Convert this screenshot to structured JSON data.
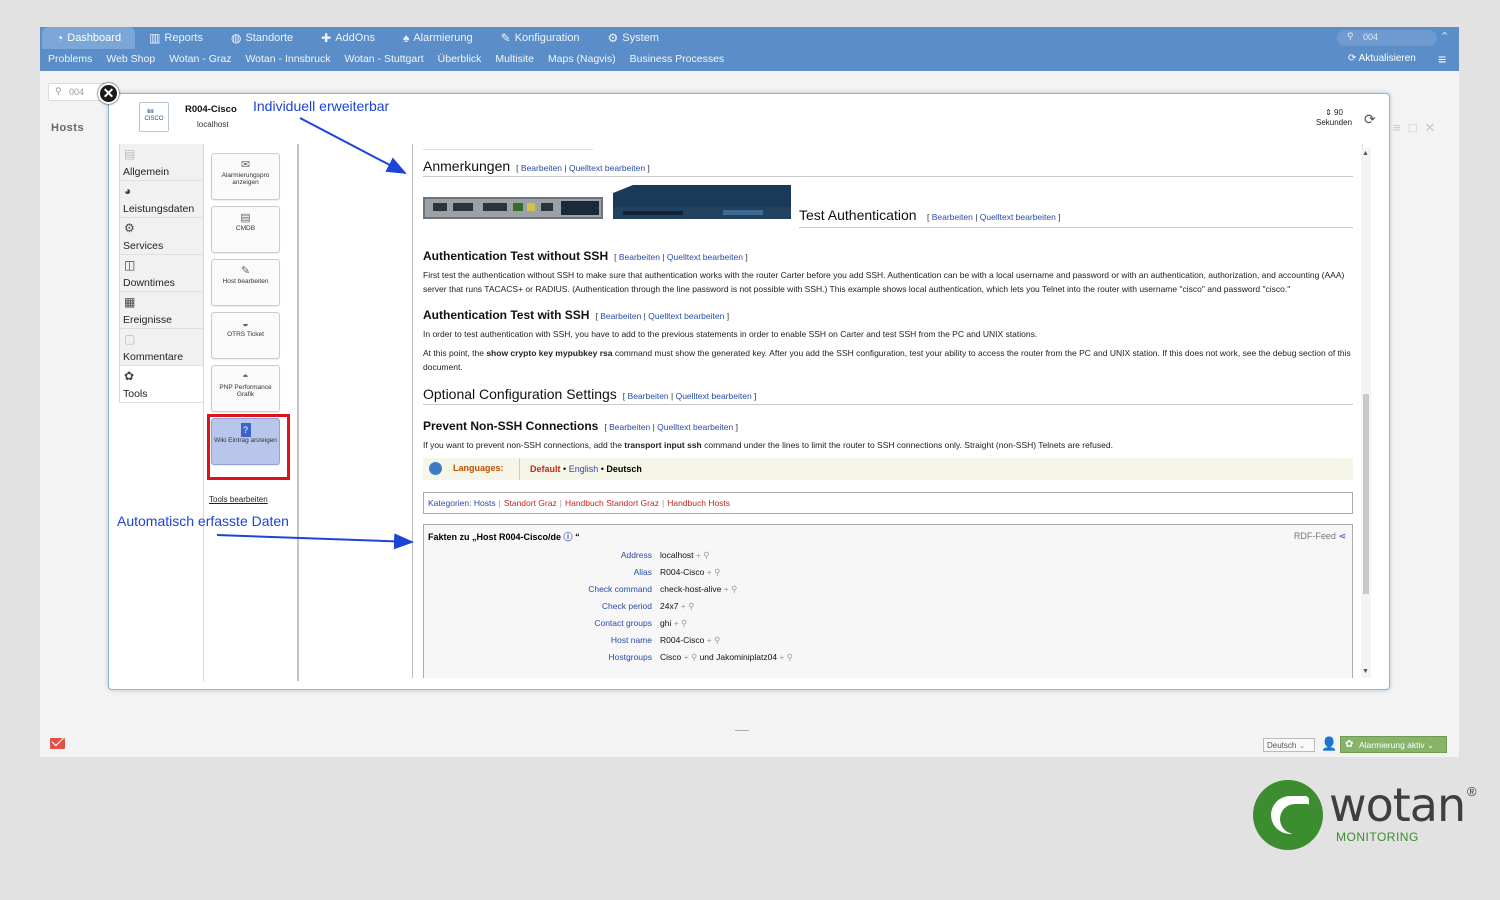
{
  "mainnav": [
    {
      "label": "Dashboard",
      "icon": "dashboard-icon",
      "glyph": "◔"
    },
    {
      "label": "Reports",
      "icon": "chart-icon",
      "glyph": "▥"
    },
    {
      "label": "Standorte",
      "icon": "globe-icon",
      "glyph": "◍"
    },
    {
      "label": "AddOns",
      "icon": "puzzle-icon",
      "glyph": "✚"
    },
    {
      "label": "Alarmierung",
      "icon": "bell-icon",
      "glyph": "♠"
    },
    {
      "label": "Konfiguration",
      "icon": "wrench-icon",
      "glyph": "✎"
    },
    {
      "label": "System",
      "icon": "gear-icon",
      "glyph": "⚙"
    }
  ],
  "subnav": [
    "Problems",
    "Web Shop",
    "Wotan - Graz",
    "Wotan - Innsbruck",
    "Wotan - Stuttgart",
    "Überblick",
    "Multisite",
    "Maps (Nagvis)",
    "Business Processes"
  ],
  "topsearch": {
    "value": "004"
  },
  "refresh_top": "Aktualisieren",
  "left": {
    "search_value": "004",
    "hosts_label": "Hosts"
  },
  "modal": {
    "host_name": "R004-Cisco",
    "host_addr": "localhost",
    "logo_text": "CISCO",
    "refresh_value": "90",
    "refresh_unit": "Sekunden",
    "categories": [
      {
        "label": "Allgemein",
        "icon": "monitor-icon",
        "glyph": "▤",
        "dim": true
      },
      {
        "label": "Leistungsdaten",
        "icon": "gauge-icon",
        "glyph": "◕",
        "dim": false
      },
      {
        "label": "Services",
        "icon": "gears-icon",
        "glyph": "⚙",
        "dim": false
      },
      {
        "label": "Downtimes",
        "icon": "clock-note-icon",
        "glyph": "◫",
        "dim": false
      },
      {
        "label": "Ereignisse",
        "icon": "calendar-icon",
        "glyph": "▦",
        "dim": false
      },
      {
        "label": "Kommentare",
        "icon": "comment-icon",
        "glyph": "▢",
        "dim": true
      },
      {
        "label": "Tools",
        "icon": "tools-icon",
        "glyph": "✿",
        "dim": false
      }
    ],
    "tools": [
      {
        "label": "Alarmierungspro anzeigen",
        "icon": "alert-doc-icon",
        "glyph": "✉"
      },
      {
        "label": "CMDB",
        "icon": "database-icon",
        "glyph": "▤"
      },
      {
        "label": "Host bearbeiten",
        "icon": "pencil-icon",
        "glyph": "✎"
      },
      {
        "label": "OTRS Ticket",
        "icon": "ticket-icon",
        "glyph": "◒"
      },
      {
        "label": "PNP Performance Grafik",
        "icon": "pnp-icon",
        "glyph": "◓"
      },
      {
        "label": "Wiki Eintrag anzeigen",
        "icon": "wiki-icon",
        "glyph": "?"
      }
    ],
    "tools_edit": "Tools bearbeiten"
  },
  "wiki": {
    "edit": "Bearbeiten",
    "source_edit": "Quelltext bearbeiten",
    "anmerkungen": "Anmerkungen",
    "test_auth": "Test Authentication",
    "auth_no_ssh_title": "Authentication Test without SSH",
    "auth_no_ssh_text": "First test the authentication without SSH to make sure that authentication works with the router Carter before you add SSH. Authentication can be with a local username and password or with an authentication, authorization, and accounting (AAA) server that runs TACACS+ or RADIUS. (Authentication through the line password is not possible with SSH.) This example shows local authentication, which lets you Telnet into the router with username \"cisco\" and password \"cisco.\"",
    "auth_ssh_title": "Authentication Test with SSH",
    "auth_ssh_text1": "In order to test authentication with SSH, you have to add to the previous statements in order to enable SSH on Carter and test SSH from the PC and UNIX stations.",
    "auth_ssh_text2a": "At this point, the ",
    "auth_ssh_text2b": "show crypto key mypubkey rsa",
    "auth_ssh_text2c": " command must show the generated key. After you add the SSH configuration, test your ability to access the router from the PC and UNIX station. If this does not work, see the debug section of this document.",
    "opt_config": "Optional Configuration Settings",
    "prevent_title": "Prevent Non-SSH Connections",
    "prevent_text_a": "If you want to prevent non-SSH connections, add the ",
    "prevent_text_b": "transport input ssh",
    "prevent_text_c": " command under the lines to limit the router to SSH connections only. Straight (non-SSH) Telnets are refused.",
    "languages_label": "Languages:",
    "lang_default": "Default",
    "lang_english": "English",
    "lang_deutsch": "Deutsch",
    "kategorien_label": "Kategorien:",
    "categories": [
      "Hosts",
      "Standort Graz",
      "Handbuch Standort Graz",
      "Handbuch Hosts"
    ],
    "facts_title": "Fakten zu „Host R004-Cisco/de",
    "rdf": "RDF-Feed",
    "facts": [
      {
        "k": "Address",
        "v": "localhost"
      },
      {
        "k": "Alias",
        "v": "R004-Cisco"
      },
      {
        "k": "Check command",
        "v": "check-host-alive"
      },
      {
        "k": "Check period",
        "v": "24x7"
      },
      {
        "k": "Contact groups",
        "v": "ghi"
      },
      {
        "k": "Host name",
        "v": "R004-Cisco"
      },
      {
        "k": "Hostgroups",
        "v": "Cisco",
        "extra": "und Jakominiplatz04"
      }
    ]
  },
  "annotations": {
    "top": "Individuell erweiterbar",
    "bottom": "Automatisch erfasste Daten"
  },
  "footer": {
    "lang": "Deutsch",
    "alarm": "Alarmierung aktiv"
  },
  "brand": {
    "word": "wotan",
    "reg": "®",
    "sub": "MONITORING",
    "green": "#3c8d2f"
  }
}
